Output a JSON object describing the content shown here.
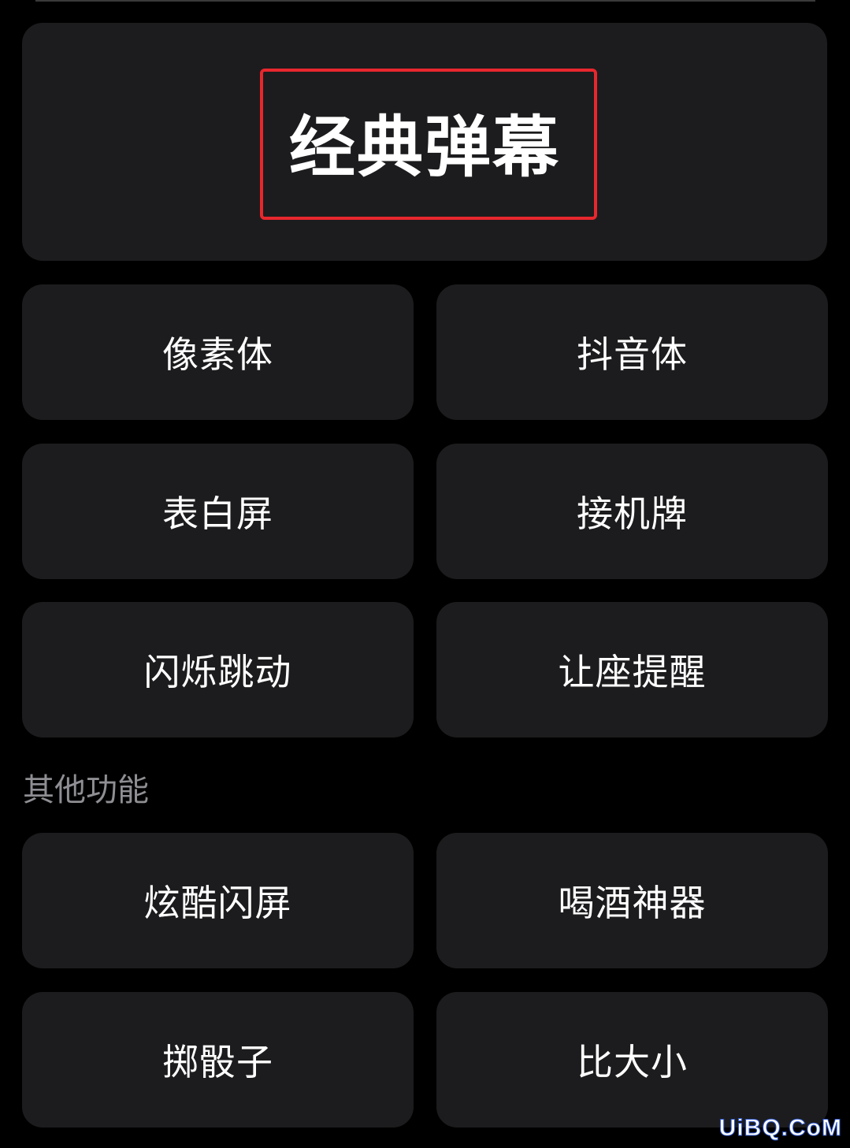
{
  "hero": {
    "title": "经典弹幕",
    "highlight_color": "#e8272d"
  },
  "modes": [
    {
      "label": "像素体"
    },
    {
      "label": "抖音体"
    },
    {
      "label": "表白屏"
    },
    {
      "label": "接机牌"
    },
    {
      "label": "闪烁跳动"
    },
    {
      "label": "让座提醒"
    }
  ],
  "other_section": {
    "heading": "其他功能",
    "items": [
      {
        "label": "炫酷闪屏"
      },
      {
        "label": "喝酒神器"
      },
      {
        "label": "掷骰子"
      },
      {
        "label": "比大小"
      }
    ]
  },
  "watermark": {
    "text": "UiBQ.CoM"
  },
  "colors": {
    "background": "#000000",
    "card": "#1c1c1e",
    "text": "#ffffff",
    "section_heading": "#8e8e93"
  }
}
